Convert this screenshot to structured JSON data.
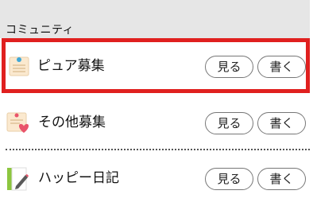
{
  "section": {
    "title": "コミュニティ"
  },
  "rows": [
    {
      "label": "ピュア募集",
      "icon": "notepad-pin-icon",
      "view_label": "見る",
      "write_label": "書く",
      "highlighted": true
    },
    {
      "label": "その他募集",
      "icon": "notepad-heart-icon",
      "view_label": "見る",
      "write_label": "書く",
      "highlighted": false
    },
    {
      "label": "ハッピー日記",
      "icon": "diary-pencil-icon",
      "view_label": "見る",
      "write_label": "書く",
      "highlighted": false
    }
  ],
  "colors": {
    "highlight_border": "#e0201f",
    "header_bg": "#e6e6e6",
    "pill_border": "#777777",
    "notepad_bg": "#fbe9cf",
    "heart": "#e9546b",
    "diary_green": "#8cc63f"
  }
}
